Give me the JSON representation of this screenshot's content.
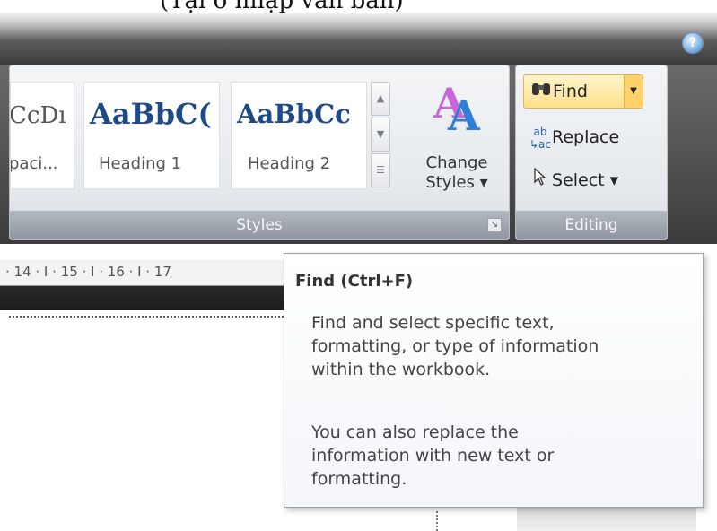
{
  "caption": {
    "text": "(Tại ô nhập văn bản)"
  },
  "ribbon": {
    "help_icon": "help-icon",
    "styles_group": {
      "label": "Styles",
      "tiles": [
        {
          "preview": "CcDı",
          "name": "paci..."
        },
        {
          "preview": "AaBbC(",
          "name": "Heading 1"
        },
        {
          "preview": "AaBbCc",
          "name": "Heading 2"
        }
      ],
      "change_styles": {
        "line1": "Change",
        "line2": "Styles ▾"
      },
      "launcher_icon": "dialog-launcher-icon"
    },
    "editing_group": {
      "label": "Editing",
      "find": "Find",
      "replace": "Replace",
      "select": "Select ▾"
    }
  },
  "ruler": {
    "text": "· 14 · I · 15 · I · 16 · I · 17"
  },
  "tooltip": {
    "title": "Find (Ctrl+F)",
    "para1_line1": "Find and select specific text,",
    "para1_line2": "formatting, or type of information",
    "para1_line3": "within the workbook.",
    "para2_line1": "You can also replace the",
    "para2_line2": "information with new text or",
    "para2_line3": "formatting."
  },
  "colors": {
    "accent_find": "#ffe08a",
    "style_heading": "#1f4a8a"
  }
}
